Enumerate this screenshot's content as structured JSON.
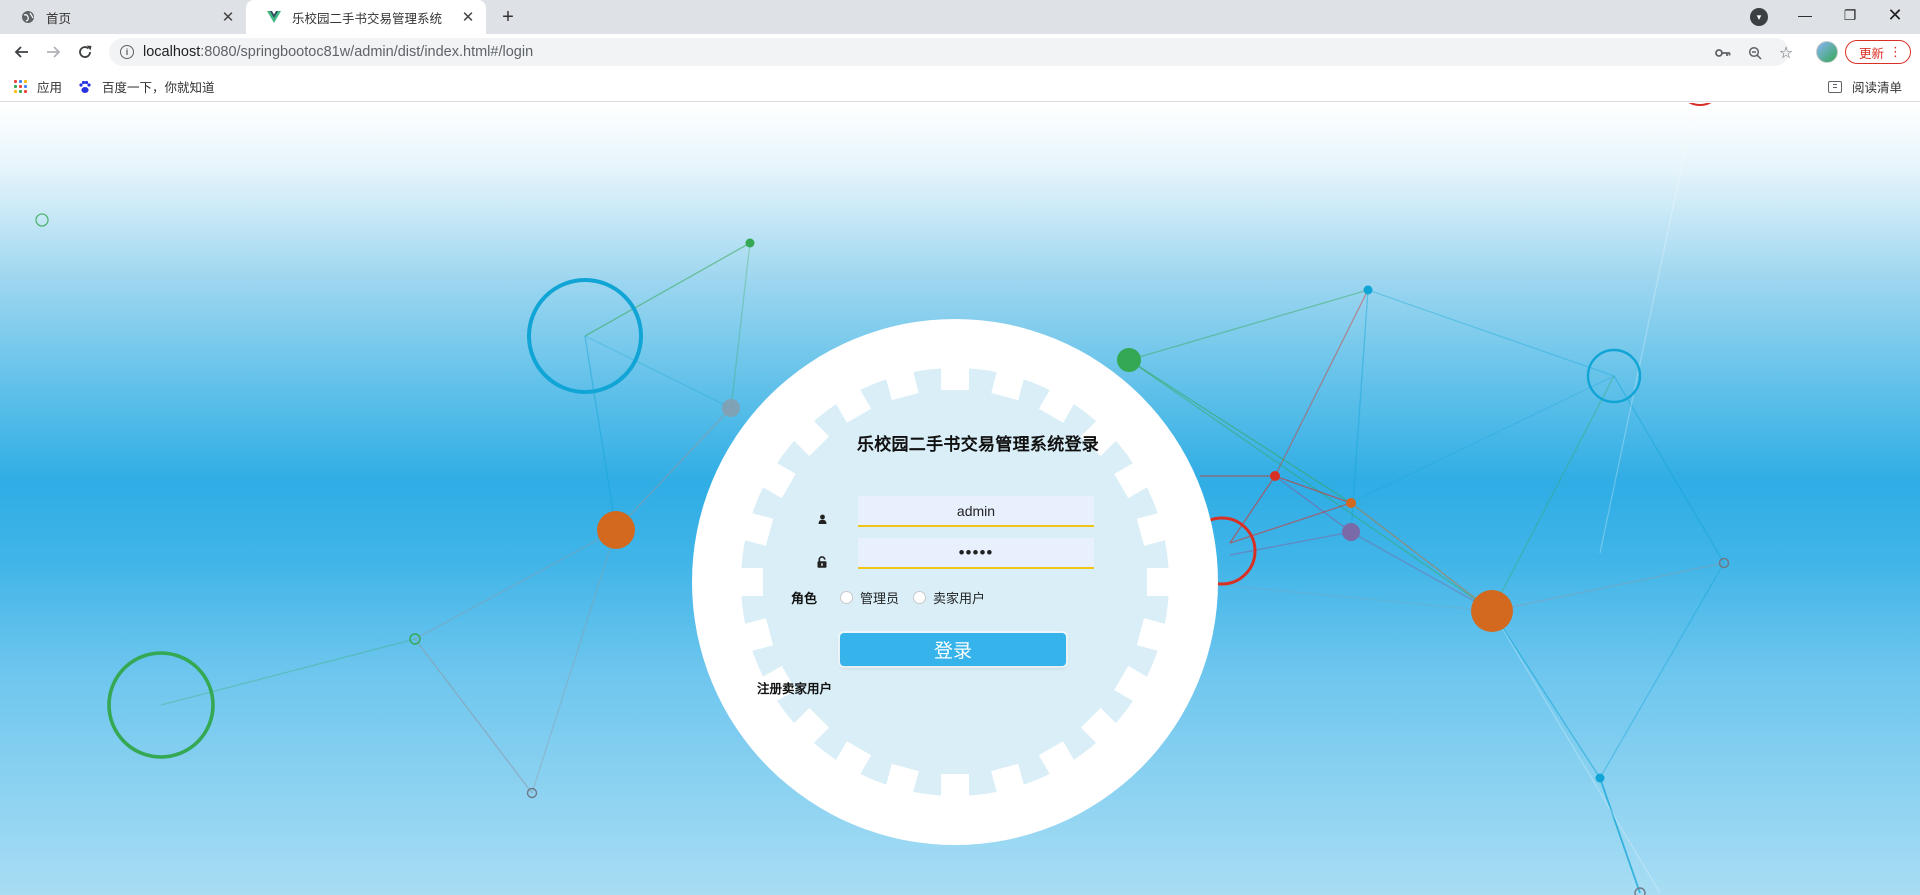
{
  "browser": {
    "tabs": [
      {
        "title": "首页",
        "active": false,
        "icon": "globe-icon"
      },
      {
        "title": "乐校园二手书交易管理系统",
        "active": true,
        "icon": "vue-logo-icon"
      }
    ],
    "new_tab_symbol": "+",
    "url_host": "localhost",
    "url_rest": ":8080/springbootoc81w/admin/dist/index.html#/login",
    "update_label": "更新",
    "window_controls": {
      "minimize": "—",
      "maximize": "❐",
      "close": "✕"
    }
  },
  "bookmarks": {
    "apps_label": "应用",
    "baidu_label": "百度一下，你就知道",
    "reading_list_label": "阅读清单"
  },
  "login": {
    "title": "乐校园二手书交易管理系统登录",
    "username_value": "admin",
    "password_value": "•••••",
    "role_label": "角色",
    "role_options": [
      "管理员",
      "卖家用户"
    ],
    "selected_role": null,
    "submit_label": "登录",
    "register_link": "注册卖家用户"
  },
  "colors": {
    "accent_button": "#36b3ea",
    "input_underline": "#f0c419",
    "input_bg": "#e8f0fe",
    "node_orange": "#d2691e",
    "node_green": "#34a853",
    "node_blue": "#11a5d6",
    "node_red": "#d93025",
    "node_purple": "#7b6aa8",
    "node_grey": "#8e9aa6"
  }
}
